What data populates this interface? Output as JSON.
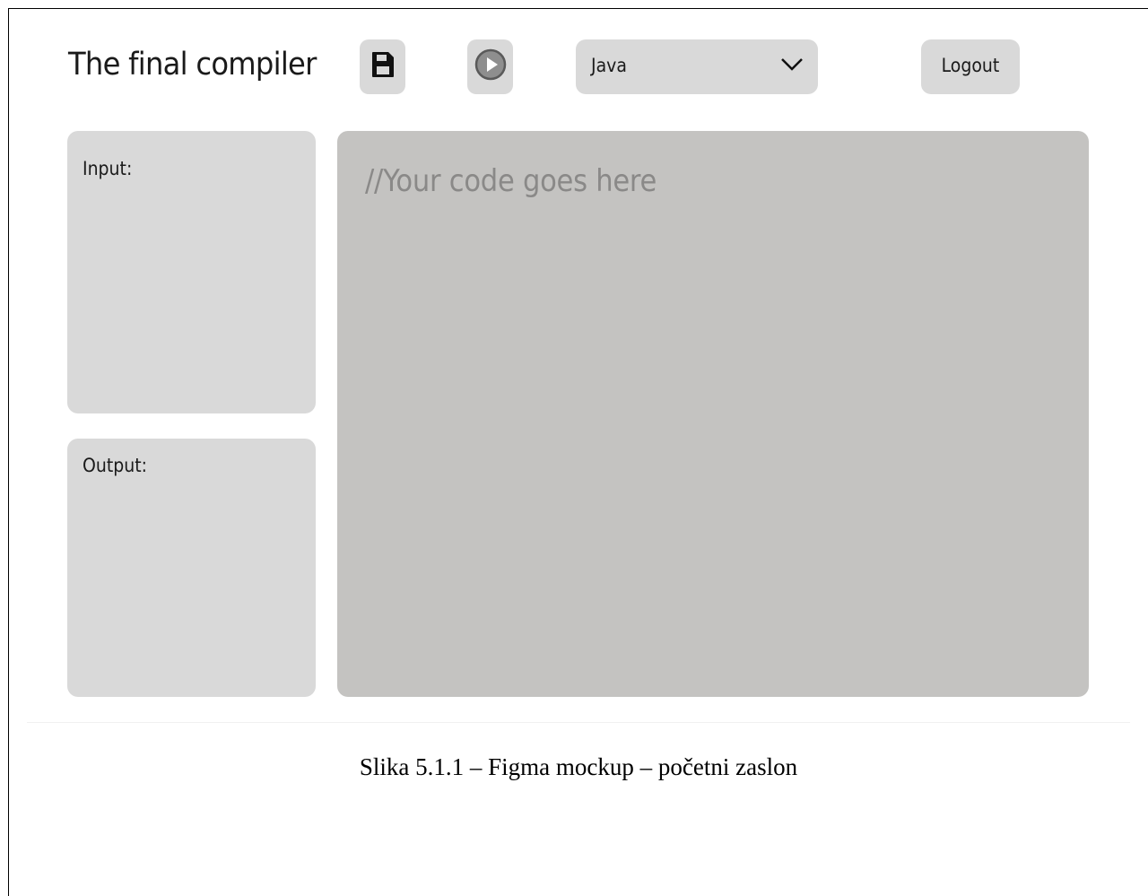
{
  "header": {
    "app_title": "The final compiler",
    "save_icon": "floppy-disk-icon",
    "run_icon": "play-circle-icon",
    "language_select": {
      "selected": "Java",
      "icon": "chevron-down-icon"
    },
    "logout_label": "Logout"
  },
  "panels": {
    "input_label": "Input:",
    "output_label": "Output:"
  },
  "editor": {
    "placeholder": "//Your code goes here"
  },
  "caption": "Slika 5.1.1 – Figma mockup – početni zaslon",
  "colors": {
    "panel": "#d9d9d9",
    "editor": "#c4c3c1",
    "placeholder_text": "#8a8988",
    "text": "#1a1a1a"
  }
}
